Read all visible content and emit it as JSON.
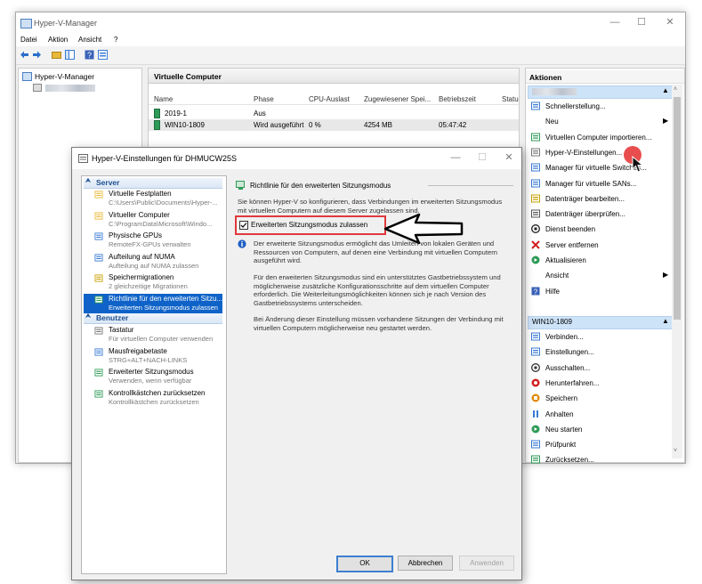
{
  "main_window": {
    "title": "Hyper-V-Manager",
    "controls": [
      "—",
      "☐",
      "✕"
    ],
    "menu": [
      "Datei",
      "Aktion",
      "Ansicht",
      "?"
    ]
  },
  "tree": {
    "root": "Hyper-V-Manager"
  },
  "vm_panel": {
    "title": "Virtuelle Computer",
    "columns": [
      "Name",
      "Phase",
      "CPU-Auslast",
      "Zugewiesener Spei...",
      "Betriebszeit",
      "Statu"
    ],
    "rows": [
      {
        "name": "2019-1",
        "phase": "Aus",
        "cpu": "",
        "mem": "",
        "uptime": ""
      },
      {
        "name": "WIN10-1809",
        "phase": "Wird ausgeführt",
        "cpu": "0 %",
        "mem": "4254 MB",
        "uptime": "05:47:42"
      }
    ]
  },
  "actions": {
    "title": "Aktionen",
    "host_items": [
      {
        "label": "Schnellerstellung...",
        "icon": "quick-create-icon",
        "color": "#3a7bd5"
      },
      {
        "label": "Neu",
        "icon": "none",
        "submenu": true
      },
      {
        "label": "Virtuellen Computer importieren...",
        "icon": "import-icon",
        "color": "#2e9b57"
      },
      {
        "label": "Hyper-V-Einstellungen...",
        "icon": "settings-page-icon",
        "color": "#777777"
      },
      {
        "label": "Manager für virtuelle Switches...",
        "icon": "switch-icon",
        "color": "#3a7bd5"
      },
      {
        "label": "Manager für virtuelle SANs...",
        "icon": "san-icon",
        "color": "#3a7bd5"
      },
      {
        "label": "Datenträger bearbeiten...",
        "icon": "disk-edit-icon",
        "color": "#c8a000"
      },
      {
        "label": "Datenträger überprüfen...",
        "icon": "disk-check-icon",
        "color": "#555555"
      },
      {
        "label": "Dienst beenden",
        "icon": "stop-service-icon",
        "color": "#222222"
      },
      {
        "label": "Server entfernen",
        "icon": "remove-x-icon",
        "color": "#d21f1f"
      },
      {
        "label": "Aktualisieren",
        "icon": "refresh-icon",
        "color": "#2e9b57"
      },
      {
        "label": "Ansicht",
        "icon": "none",
        "submenu": true
      },
      {
        "label": "Hilfe",
        "icon": "help-icon",
        "color": "#3a62b8"
      }
    ],
    "vm_section": "WIN10-1809",
    "vm_items": [
      {
        "label": "Verbinden...",
        "icon": "connect-icon",
        "color": "#3a7bd5"
      },
      {
        "label": "Einstellungen...",
        "icon": "settings-icon",
        "color": "#3a7bd5"
      },
      {
        "label": "Ausschalten...",
        "icon": "power-off-icon",
        "color": "#333333"
      },
      {
        "label": "Herunterfahren...",
        "icon": "shutdown-icon",
        "color": "#d21f1f"
      },
      {
        "label": "Speichern",
        "icon": "save-icon",
        "color": "#e08a00"
      },
      {
        "label": "Anhalten",
        "icon": "pause-icon",
        "color": "#3a7bd5"
      },
      {
        "label": "Neu starten",
        "icon": "restart-icon",
        "color": "#2e9b57"
      },
      {
        "label": "Prüfpunkt",
        "icon": "checkpoint-icon",
        "color": "#3a7bd5"
      },
      {
        "label": "Zurücksetzen...",
        "icon": "revert-icon",
        "color": "#2e9b57"
      }
    ]
  },
  "dialog": {
    "title": "Hyper-V-Einstellungen für DHMUCW25S",
    "controls": [
      "—",
      "☐",
      "✕"
    ],
    "nav": {
      "server_header": "Server",
      "server_items": [
        {
          "title": "Virtuelle Festplatten",
          "sub": "C:\\Users\\Public\\Documents\\Hyper-...",
          "icon": "folder-icon",
          "color": "#e8b93a"
        },
        {
          "title": "Virtueller Computer",
          "sub": "C:\\ProgramData\\Microsoft\\Windo...",
          "icon": "vm-folder-icon",
          "color": "#e8b93a"
        },
        {
          "title": "Physische GPUs",
          "sub": "RemoteFX-GPUs verwalten",
          "icon": "gpu-icon",
          "color": "#3a7bd5"
        },
        {
          "title": "Aufteilung auf NUMA",
          "sub": "Aufteilung auf NUMA zulassen",
          "icon": "numa-icon",
          "color": "#3a7bd5"
        },
        {
          "title": "Speichermigrationen",
          "sub": "2 gleichzeitige Migrationen",
          "icon": "migration-icon",
          "color": "#c8a000"
        },
        {
          "title": "Richtlinie für den erweiterten Sitzu...",
          "sub": "Erweiterten Sitzungsmodus zulassen",
          "icon": "session-policy-icon",
          "color": "#2e9b57",
          "selected": true
        }
      ],
      "user_header": "Benutzer",
      "user_items": [
        {
          "title": "Tastatur",
          "sub": "Für virtuellen Computer verwenden",
          "icon": "keyboard-icon",
          "color": "#777777"
        },
        {
          "title": "Mausfreigabetaste",
          "sub": "STRG+ALT+NACH-LINKS",
          "icon": "mouse-icon",
          "color": "#3a7bd5"
        },
        {
          "title": "Erweiterter Sitzungsmodus",
          "sub": "Verwenden, wenn verfügbar",
          "icon": "session-icon",
          "color": "#2e9b57"
        },
        {
          "title": "Kontrollkästchen zurücksetzen",
          "sub": "Kontrollkästchen zurücksetzen",
          "icon": "reset-checkbox-icon",
          "color": "#2e9b57"
        }
      ]
    },
    "content": {
      "heading": "Richtlinie für den erweiterten Sitzungsmodus",
      "intro": "Sie können Hyper-V so konfigurieren, dass Verbindungen im erweiterten Sitzungsmodus mit virtuellen Computern auf diesem Server zugelassen sind.",
      "checkbox_label": "Erweiterten Sitzungsmodus zulassen",
      "checkbox_checked": true,
      "info1": "Der erweiterte Sitzungsmodus ermöglicht das Umleiten von lokalen Geräten und Ressourcen von Computern, auf denen eine Verbindung mit virtuellen Computern ausgeführt wird.",
      "info2": "Für den erweiterten Sitzungsmodus sind ein unterstütztes Gastbetriebssystem und möglicherweise zusätzliche Konfigurationsschritte auf dem virtuellen Computer erforderlich. Die Weiterleitungsmöglichkeiten können sich je nach Version des Gastbetriebssystems unterscheiden.",
      "info3": "Bei Änderung dieser Einstellung müssen vorhandene Sitzungen der Verbindung mit virtuellen Computern möglicherweise neu gestartet werden."
    },
    "buttons": {
      "ok": "OK",
      "cancel": "Abbrechen",
      "apply": "Anwenden"
    }
  },
  "colors": {
    "selection": "#0f63c8",
    "section_blue": "#cde3f8",
    "highlight_red": "#e0393e",
    "cursor_dot": "#e63b3b"
  }
}
